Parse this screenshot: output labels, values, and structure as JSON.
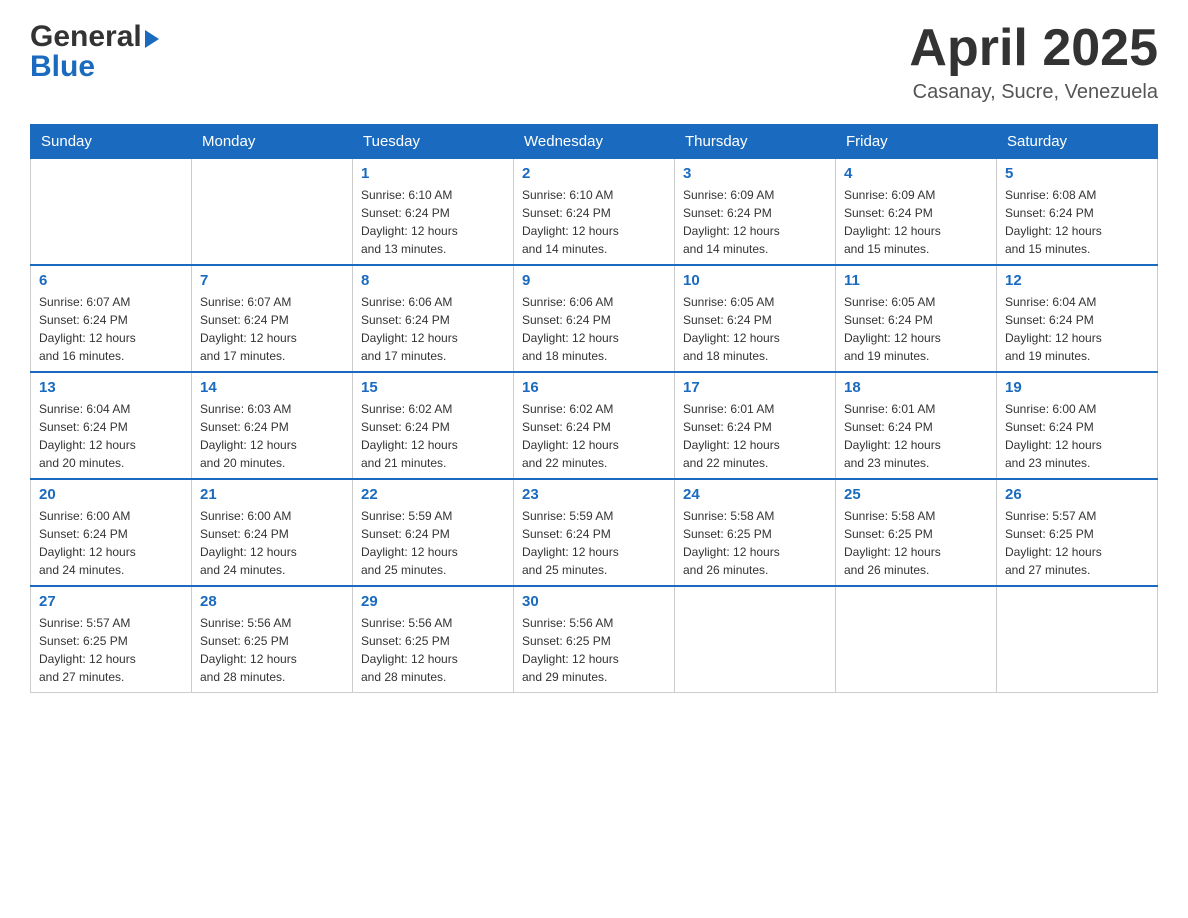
{
  "header": {
    "logo_text1": "General",
    "logo_text2": "Blue",
    "title": "April 2025",
    "subtitle": "Casanay, Sucre, Venezuela"
  },
  "calendar": {
    "days_of_week": [
      "Sunday",
      "Monday",
      "Tuesday",
      "Wednesday",
      "Thursday",
      "Friday",
      "Saturday"
    ],
    "weeks": [
      [
        {
          "day": "",
          "info": ""
        },
        {
          "day": "",
          "info": ""
        },
        {
          "day": "1",
          "info": "Sunrise: 6:10 AM\nSunset: 6:24 PM\nDaylight: 12 hours\nand 13 minutes."
        },
        {
          "day": "2",
          "info": "Sunrise: 6:10 AM\nSunset: 6:24 PM\nDaylight: 12 hours\nand 14 minutes."
        },
        {
          "day": "3",
          "info": "Sunrise: 6:09 AM\nSunset: 6:24 PM\nDaylight: 12 hours\nand 14 minutes."
        },
        {
          "day": "4",
          "info": "Sunrise: 6:09 AM\nSunset: 6:24 PM\nDaylight: 12 hours\nand 15 minutes."
        },
        {
          "day": "5",
          "info": "Sunrise: 6:08 AM\nSunset: 6:24 PM\nDaylight: 12 hours\nand 15 minutes."
        }
      ],
      [
        {
          "day": "6",
          "info": "Sunrise: 6:07 AM\nSunset: 6:24 PM\nDaylight: 12 hours\nand 16 minutes."
        },
        {
          "day": "7",
          "info": "Sunrise: 6:07 AM\nSunset: 6:24 PM\nDaylight: 12 hours\nand 17 minutes."
        },
        {
          "day": "8",
          "info": "Sunrise: 6:06 AM\nSunset: 6:24 PM\nDaylight: 12 hours\nand 17 minutes."
        },
        {
          "day": "9",
          "info": "Sunrise: 6:06 AM\nSunset: 6:24 PM\nDaylight: 12 hours\nand 18 minutes."
        },
        {
          "day": "10",
          "info": "Sunrise: 6:05 AM\nSunset: 6:24 PM\nDaylight: 12 hours\nand 18 minutes."
        },
        {
          "day": "11",
          "info": "Sunrise: 6:05 AM\nSunset: 6:24 PM\nDaylight: 12 hours\nand 19 minutes."
        },
        {
          "day": "12",
          "info": "Sunrise: 6:04 AM\nSunset: 6:24 PM\nDaylight: 12 hours\nand 19 minutes."
        }
      ],
      [
        {
          "day": "13",
          "info": "Sunrise: 6:04 AM\nSunset: 6:24 PM\nDaylight: 12 hours\nand 20 minutes."
        },
        {
          "day": "14",
          "info": "Sunrise: 6:03 AM\nSunset: 6:24 PM\nDaylight: 12 hours\nand 20 minutes."
        },
        {
          "day": "15",
          "info": "Sunrise: 6:02 AM\nSunset: 6:24 PM\nDaylight: 12 hours\nand 21 minutes."
        },
        {
          "day": "16",
          "info": "Sunrise: 6:02 AM\nSunset: 6:24 PM\nDaylight: 12 hours\nand 22 minutes."
        },
        {
          "day": "17",
          "info": "Sunrise: 6:01 AM\nSunset: 6:24 PM\nDaylight: 12 hours\nand 22 minutes."
        },
        {
          "day": "18",
          "info": "Sunrise: 6:01 AM\nSunset: 6:24 PM\nDaylight: 12 hours\nand 23 minutes."
        },
        {
          "day": "19",
          "info": "Sunrise: 6:00 AM\nSunset: 6:24 PM\nDaylight: 12 hours\nand 23 minutes."
        }
      ],
      [
        {
          "day": "20",
          "info": "Sunrise: 6:00 AM\nSunset: 6:24 PM\nDaylight: 12 hours\nand 24 minutes."
        },
        {
          "day": "21",
          "info": "Sunrise: 6:00 AM\nSunset: 6:24 PM\nDaylight: 12 hours\nand 24 minutes."
        },
        {
          "day": "22",
          "info": "Sunrise: 5:59 AM\nSunset: 6:24 PM\nDaylight: 12 hours\nand 25 minutes."
        },
        {
          "day": "23",
          "info": "Sunrise: 5:59 AM\nSunset: 6:24 PM\nDaylight: 12 hours\nand 25 minutes."
        },
        {
          "day": "24",
          "info": "Sunrise: 5:58 AM\nSunset: 6:25 PM\nDaylight: 12 hours\nand 26 minutes."
        },
        {
          "day": "25",
          "info": "Sunrise: 5:58 AM\nSunset: 6:25 PM\nDaylight: 12 hours\nand 26 minutes."
        },
        {
          "day": "26",
          "info": "Sunrise: 5:57 AM\nSunset: 6:25 PM\nDaylight: 12 hours\nand 27 minutes."
        }
      ],
      [
        {
          "day": "27",
          "info": "Sunrise: 5:57 AM\nSunset: 6:25 PM\nDaylight: 12 hours\nand 27 minutes."
        },
        {
          "day": "28",
          "info": "Sunrise: 5:56 AM\nSunset: 6:25 PM\nDaylight: 12 hours\nand 28 minutes."
        },
        {
          "day": "29",
          "info": "Sunrise: 5:56 AM\nSunset: 6:25 PM\nDaylight: 12 hours\nand 28 minutes."
        },
        {
          "day": "30",
          "info": "Sunrise: 5:56 AM\nSunset: 6:25 PM\nDaylight: 12 hours\nand 29 minutes."
        },
        {
          "day": "",
          "info": ""
        },
        {
          "day": "",
          "info": ""
        },
        {
          "day": "",
          "info": ""
        }
      ]
    ]
  }
}
